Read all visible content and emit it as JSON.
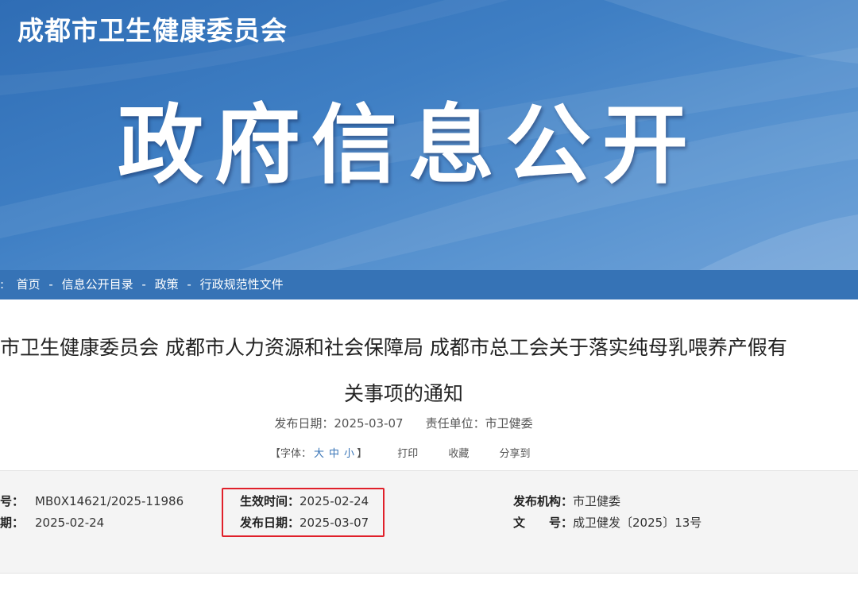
{
  "header": {
    "site_name": "成都市卫生健康委员会",
    "banner_title": "政府信息公开"
  },
  "breadcrumb": {
    "prefix": ":",
    "items": [
      "首页",
      "信息公开目录",
      "政策",
      "行政规范性文件"
    ],
    "separator": "-"
  },
  "article": {
    "title_line1": "市卫生健康委员会 成都市人力资源和社会保障局 成都市总工会关于落实纯母乳喂养产假有",
    "title_line2": "关事项的通知",
    "publish_date_label": "发布日期：",
    "publish_date": "2025-03-07",
    "responsible_unit_label": "责任单位：",
    "responsible_unit": "市卫健委"
  },
  "toolbar": {
    "font_label_open": "【字体：",
    "font_large": "大",
    "font_medium": "中",
    "font_small": "小",
    "font_label_close": "】",
    "print": "打印",
    "favorite": "收藏",
    "share": "分享到"
  },
  "info": {
    "index_label": "号：",
    "index_value": "MB0X14621/2025-11986",
    "date_label": "期：",
    "date_value": "2025-02-24",
    "effective_label": "生效时间：",
    "effective_value": "2025-02-24",
    "publish_label": "发布日期：",
    "publish_value": "2025-03-07",
    "org_label": "发布机构：",
    "org_value": "市卫健委",
    "docno_label": "文　　号：",
    "docno_value": "成卫健发〔2025〕13号"
  },
  "colors": {
    "banner": "#3f7fc4",
    "breadcrumb_bar": "#3673b6",
    "highlight_box": "#e0202a",
    "info_background": "#f4f4f4"
  }
}
